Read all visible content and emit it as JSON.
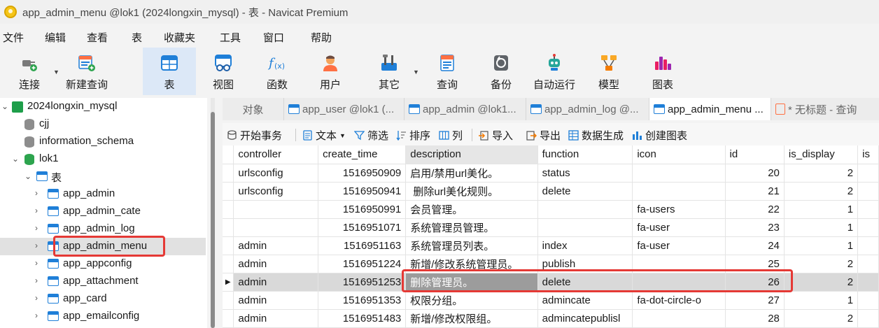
{
  "window": {
    "title": "app_admin_menu @lok1 (2024longxin_mysql) - 表 - Navicat Premium"
  },
  "menu": [
    "文件",
    "编辑",
    "查看",
    "表",
    "收藏夹",
    "工具",
    "窗口",
    "帮助"
  ],
  "toolbar": [
    {
      "label": "连接",
      "icon": "plug-icon"
    },
    {
      "label": "新建查询",
      "icon": "new-query-icon"
    },
    {
      "label": "表",
      "icon": "table-icon"
    },
    {
      "label": "视图",
      "icon": "view-icon"
    },
    {
      "label": "函数",
      "icon": "function-icon"
    },
    {
      "label": "用户",
      "icon": "user-icon"
    },
    {
      "label": "其它",
      "icon": "tools-icon"
    },
    {
      "label": "查询",
      "icon": "query-icon"
    },
    {
      "label": "备份",
      "icon": "backup-icon"
    },
    {
      "label": "自动运行",
      "icon": "robot-icon"
    },
    {
      "label": "模型",
      "icon": "model-icon"
    },
    {
      "label": "图表",
      "icon": "chart-icon"
    }
  ],
  "sidebar": {
    "connection": "2024longxin_mysql",
    "databases": [
      "cjj",
      "information_schema",
      "lok1"
    ],
    "tables_group": "表",
    "tables": [
      "app_admin",
      "app_admin_cate",
      "app_admin_log",
      "app_admin_menu",
      "app_appconfig",
      "app_attachment",
      "app_card",
      "app_emailconfig"
    ],
    "selected_table": "app_admin_menu"
  },
  "tabs": [
    {
      "label": "对象"
    },
    {
      "label": "app_user @lok1 (..."
    },
    {
      "label": "app_admin @lok1..."
    },
    {
      "label": "app_admin_log @..."
    },
    {
      "label": "app_admin_menu ..."
    },
    {
      "label": "* 无标题 - 查询"
    }
  ],
  "object_toolbar": [
    "开始事务",
    "文本",
    "筛选",
    "排序",
    "列",
    "导入",
    "导出",
    "数据生成",
    "创建图表"
  ],
  "grid": {
    "columns": [
      "controller",
      "create_time",
      "description",
      "function",
      "icon",
      "id",
      "is_display",
      "is"
    ],
    "rows": [
      [
        "urlsconfig",
        "1516950909",
        "启用/禁用url美化。",
        "status",
        "",
        "20",
        "2"
      ],
      [
        "urlsconfig",
        "1516950941",
        " 删除url美化规则。",
        "delete",
        "",
        "21",
        "2"
      ],
      [
        "",
        "1516950991",
        "会员管理。",
        "",
        "fa-users",
        "22",
        "1"
      ],
      [
        "",
        "1516951071",
        "系统管理员管理。",
        "",
        "fa-user",
        "23",
        "1"
      ],
      [
        "admin",
        "1516951163",
        "系统管理员列表。",
        "index",
        "fa-user",
        "24",
        "1"
      ],
      [
        "admin",
        "1516951224",
        "新增/修改系统管理员。",
        "publish",
        "",
        "25",
        "2"
      ],
      [
        "admin",
        "1516951253",
        "删除管理员。",
        "delete",
        "",
        "26",
        "2"
      ],
      [
        "admin",
        "1516951353",
        "权限分组。",
        "admincate",
        "fa-dot-circle-o",
        "27",
        "1"
      ],
      [
        "admin",
        "1516951483",
        "新增/修改权限组。",
        "admincatepublisl",
        "",
        "28",
        "2"
      ]
    ],
    "current_row": 6
  },
  "colors": {
    "highlight": "#e53935",
    "accent": "#1f7fd8",
    "connection": "#1e9e4a"
  }
}
